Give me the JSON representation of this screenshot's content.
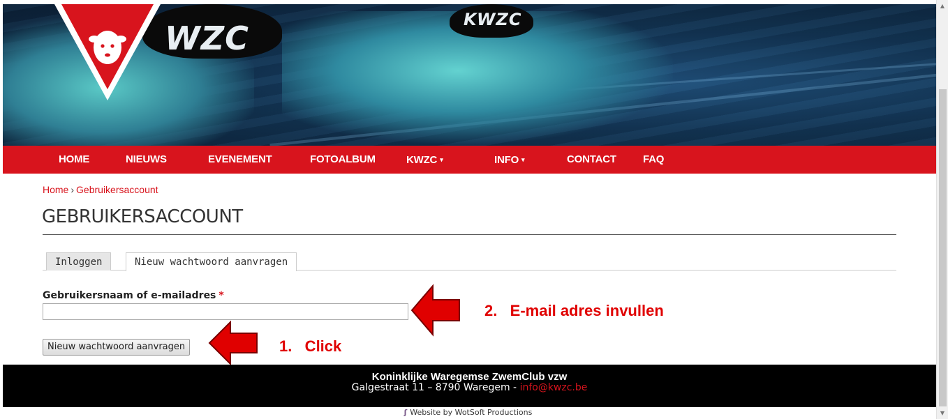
{
  "hero": {
    "cap_text_left": "WZC",
    "cap_text_right": "KWZC",
    "logo_alt": "KWZC logo"
  },
  "nav": {
    "items": [
      {
        "label": "HOME"
      },
      {
        "label": "NIEUWS"
      },
      {
        "label": "EVENEMENT"
      },
      {
        "label": "FOTOALBUM"
      },
      {
        "label": "KWZC",
        "dropdown": true
      },
      {
        "label": "INFO",
        "dropdown": true
      },
      {
        "label": "CONTACT"
      },
      {
        "label": "FAQ"
      }
    ],
    "caret": "▾",
    "color": "#d8141d"
  },
  "breadcrumb": {
    "home": "Home",
    "separator": "›",
    "current": "Gebruikersaccount"
  },
  "page": {
    "title": "GEBRUIKERSACCOUNT"
  },
  "tabs": [
    {
      "label": "Inloggen",
      "active": false
    },
    {
      "label": "Nieuw wachtwoord aanvragen",
      "active": true
    }
  ],
  "form": {
    "label": "Gebruikersnaam of e-mailadres",
    "required_marker": "*",
    "value": "",
    "placeholder": "",
    "submit_label": "Nieuw wachtwoord aanvragen"
  },
  "annotations": {
    "step1": "1.   Click",
    "step2": "2.   E-mail adres invullen",
    "color": "#e00000"
  },
  "footer": {
    "org": "Koninklijke Waregemse ZwemClub vzw",
    "address": "Galgestraat 11 – 8790 Waregem - ",
    "email": "info@kwzc.be"
  },
  "credits": {
    "text": "Website by WotSoft Productions"
  }
}
